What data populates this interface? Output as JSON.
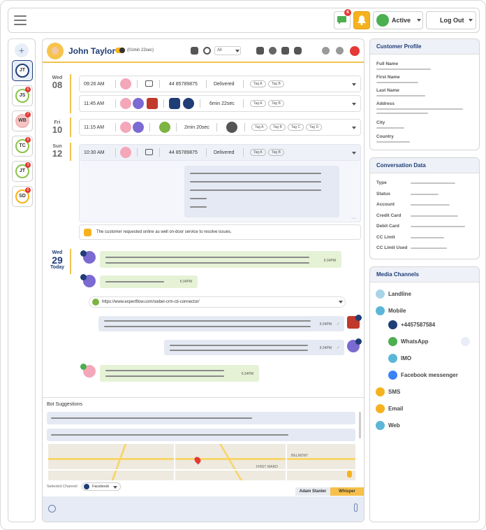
{
  "topbar": {
    "chat_badge": "6",
    "status_label": "Active",
    "logout_label": "Log Out"
  },
  "sidebar": {
    "add_label": "+",
    "customers": [
      {
        "initials": "JT",
        "badge": "",
        "ring": "#1f3d76",
        "bg": "#fff"
      },
      {
        "initials": "JS",
        "badge": "5",
        "ring": "#8bc34a",
        "bg": "#fff"
      },
      {
        "initials": "WB",
        "badge": "7",
        "ring": "#f2b5b5",
        "bg": "#f6c4c4"
      },
      {
        "initials": "TC",
        "badge": "9",
        "ring": "#8bc34a",
        "bg": "#fff"
      },
      {
        "initials": "JT",
        "badge": "3",
        "ring": "#8bc34a",
        "bg": "#fff"
      },
      {
        "initials": "SD",
        "badge": "6",
        "ring": "#f6b21e",
        "bg": "#fff"
      }
    ]
  },
  "conversation": {
    "customer_name": "John Taylor",
    "call_timer": "(01min 22sec)",
    "filter_value": "All",
    "days": [
      {
        "day": "Wed",
        "num": "08"
      },
      {
        "day": "Fri",
        "num": "10"
      },
      {
        "day": "Sun",
        "num": "12"
      }
    ],
    "today": {
      "day": "Wed",
      "num": "29",
      "label": "Today"
    },
    "rows": [
      {
        "time": "09:26 AM",
        "number": "44 85789875",
        "status": "Delivered",
        "tags": [
          "Tag A",
          "Tag B"
        ]
      },
      {
        "time": "11:45 AM",
        "duration": "6min 22sec",
        "tags": [
          "Tag A",
          "Tag B"
        ]
      },
      {
        "time": "11:15 AM",
        "duration": "2min 20sec",
        "tags": [
          "Tag A",
          "Tag B",
          "Tag C",
          "Tag D"
        ]
      },
      {
        "time": "10:30 AM",
        "number": "44 85789875",
        "status": "Delivered",
        "tags": [
          "Tag A",
          "Tag B"
        ]
      }
    ],
    "note": "The customer requested online as well on-door service to resolve issues.",
    "messages": [
      {
        "time": "6:34PM"
      },
      {
        "time": "6:34PM"
      },
      {
        "time": "6:34PM"
      },
      {
        "time": "6:34PM"
      },
      {
        "time": "6:34PM"
      }
    ],
    "link_url": "https://www.expertflow.com/siebel-crm-cti-connector/",
    "bot_suggestions_label": "Bot Suggestions",
    "selected_channel_label": "Selected Channel:",
    "channel_value": "Facebook",
    "agent_tab": "Adam Stanler",
    "whisper_tab": "Whisper",
    "map_labels": [
      "BELMONT",
      "FIRST WARD"
    ]
  },
  "profile": {
    "title": "Customer Profile",
    "fields": [
      "Full Name",
      "First Name",
      "Last Name",
      "Address",
      "City",
      "Country"
    ]
  },
  "conv_data": {
    "title": "Conversation Data",
    "fields": [
      "Type",
      "Status",
      "Account",
      "Credit Card",
      "Debit Card",
      "CC Limit",
      "CC Limit Used"
    ]
  },
  "media": {
    "title": "Media Channels",
    "landline": "Landline",
    "mobile": "Mobile",
    "phone": "+4457587584",
    "whatsapp": "WhatsApp",
    "imo": "IMO",
    "facebook": "Facebook messenger",
    "sms": "SMS",
    "email": "Email",
    "web": "Web"
  },
  "colors": {
    "accent": "#1f3d76",
    "highlight": "#f6b21e",
    "success": "#4caf50",
    "danger": "#e53935"
  }
}
